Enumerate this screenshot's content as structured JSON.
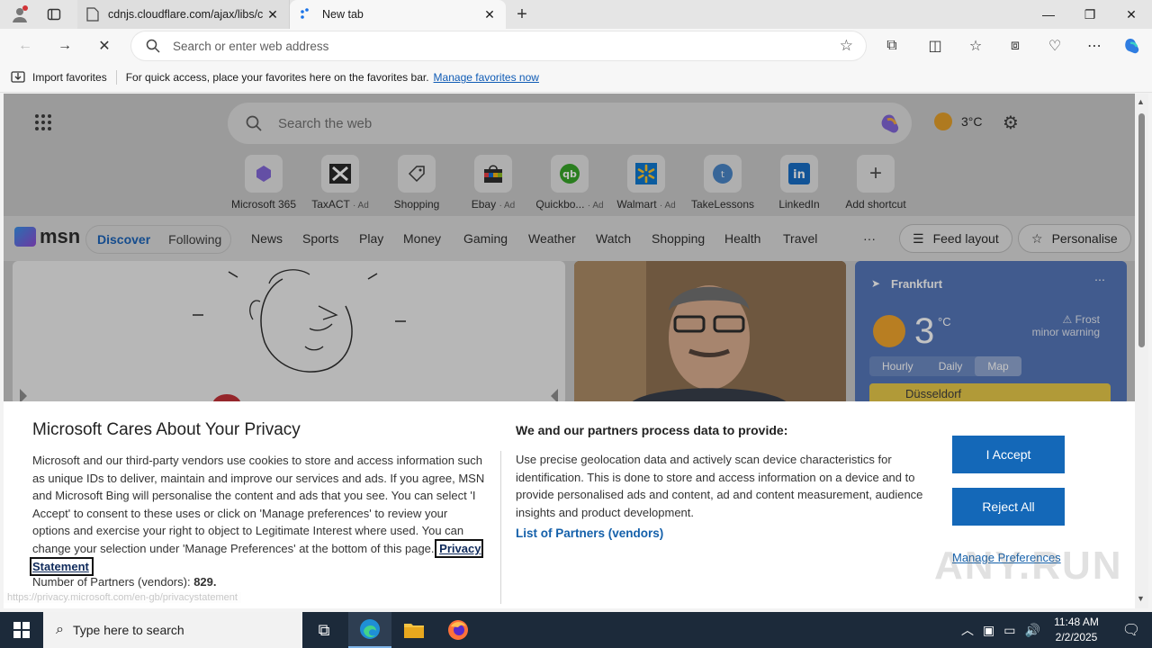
{
  "browser": {
    "tabs": [
      {
        "title": "cdnjs.cloudflare.com/ajax/libs/c",
        "active": false
      },
      {
        "title": "New tab",
        "active": true
      }
    ],
    "address_placeholder": "Search or enter web address",
    "favorites_bar": {
      "import_label": "Import favorites",
      "message": "For quick access, place your favorites here on the favorites bar.",
      "manage_link": "Manage favorites now"
    }
  },
  "newtab": {
    "search_placeholder": "Search the web",
    "weather_temp": "3°C",
    "shortcuts": [
      {
        "label": "Microsoft 365",
        "ad": ""
      },
      {
        "label": "TaxACT",
        "ad": "· Ad"
      },
      {
        "label": "Shopping",
        "ad": ""
      },
      {
        "label": "Ebay",
        "ad": "· Ad"
      },
      {
        "label": "Quickbo...",
        "ad": "· Ad"
      },
      {
        "label": "Walmart",
        "ad": "· Ad"
      },
      {
        "label": "TakeLessons",
        "ad": ""
      },
      {
        "label": "LinkedIn",
        "ad": ""
      },
      {
        "label": "Add shortcut",
        "ad": ""
      }
    ],
    "msn": {
      "logo": "msn",
      "discover": "Discover",
      "following": "Following",
      "nav": [
        "News",
        "Sports",
        "Play",
        "Money",
        "Gaming",
        "Weather",
        "Watch",
        "Shopping",
        "Health",
        "Travel"
      ],
      "more": "···",
      "feed_layout": "Feed layout",
      "personalise": "Personalise"
    },
    "weather_card": {
      "city": "Frankfurt",
      "temp": "3",
      "unit": "°C",
      "warning_line1": "Frost",
      "warning_line2": "minor warning",
      "tabs": [
        "Hourly",
        "Daily",
        "Map"
      ],
      "map_label": "Düsseldorf"
    }
  },
  "privacy": {
    "title": "Microsoft Cares About Your Privacy",
    "body": "Microsoft and our third-party vendors use cookies to store and access information such as unique IDs to deliver, maintain and improve our services and ads. If you agree, MSN and Microsoft Bing will personalise the content and ads that you see. You can select 'I Accept' to consent to these uses or click on 'Manage preferences' to review your options and exercise your right to object to Legitimate Interest where used. You can change your selection under 'Manage Preferences' at the bottom of this page.",
    "privacy_link": "Privacy Statement",
    "partners_count_label": "Number of Partners (vendors):",
    "partners_count": "829.",
    "process_title": "We and our partners process data to provide:",
    "process_body": "Use precise geolocation data and actively scan device characteristics for identification. This is done to store and access information on a device and to provide personalised ads and content, ad and content measurement, audience insights and product development.",
    "partners_link": "List of Partners (vendors)",
    "accept": "I Accept",
    "reject": "Reject All",
    "manage": "Manage Preferences",
    "status_url": "https://privacy.microsoft.com/en-gb/privacystatement",
    "watermark": "ANY.RUN"
  },
  "taskbar": {
    "search_placeholder": "Type here to search",
    "time": "11:48 AM",
    "date": "2/2/2025"
  }
}
